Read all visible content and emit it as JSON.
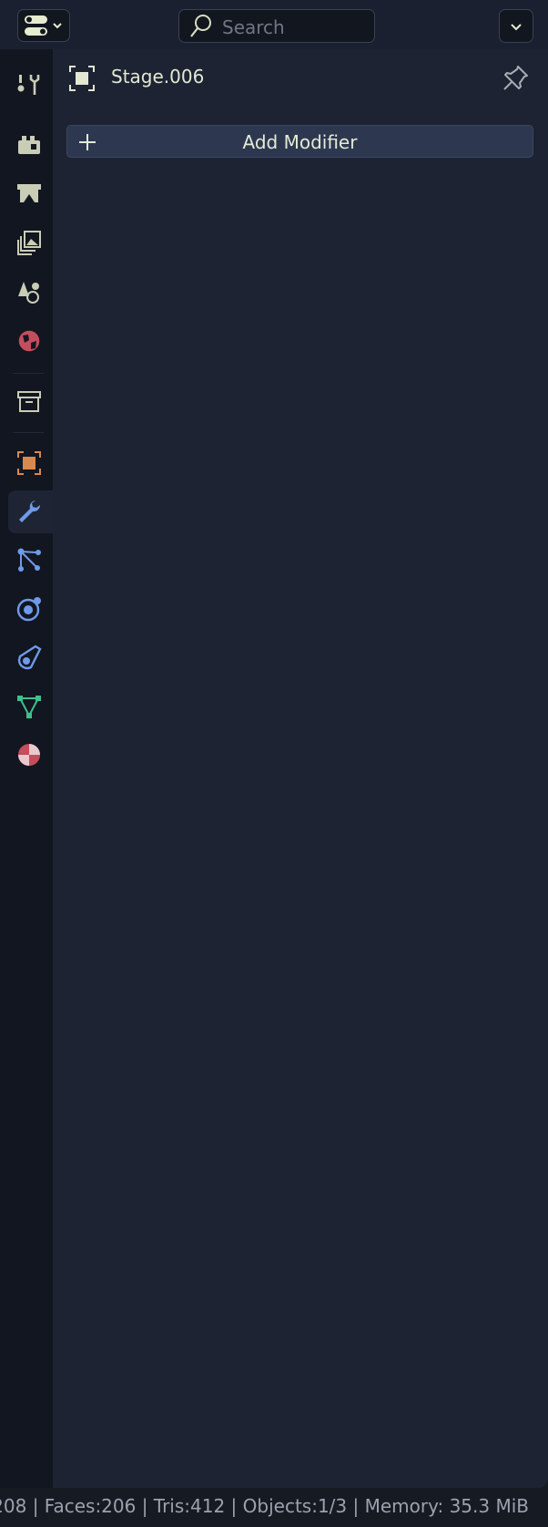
{
  "header": {
    "search_placeholder": "Search"
  },
  "properties": {
    "object_name": "Stage.006",
    "add_modifier_label": "Add Modifier"
  },
  "tabs": [
    {
      "name": "tool",
      "active": false
    },
    {
      "name": "render",
      "active": false
    },
    {
      "name": "output",
      "active": false
    },
    {
      "name": "view-layer",
      "active": false
    },
    {
      "name": "scene",
      "active": false
    },
    {
      "name": "world",
      "active": false
    },
    {
      "name": "collection",
      "active": false
    },
    {
      "name": "object",
      "active": false
    },
    {
      "name": "modifiers",
      "active": true
    },
    {
      "name": "particles",
      "active": false
    },
    {
      "name": "physics",
      "active": false
    },
    {
      "name": "constraints",
      "active": false
    },
    {
      "name": "data",
      "active": false
    },
    {
      "name": "material",
      "active": false
    }
  ],
  "status_bar": {
    "text": "208 | Faces:206 | Tris:412 | Objects:1/3 | Memory: 35.3 MiB"
  }
}
